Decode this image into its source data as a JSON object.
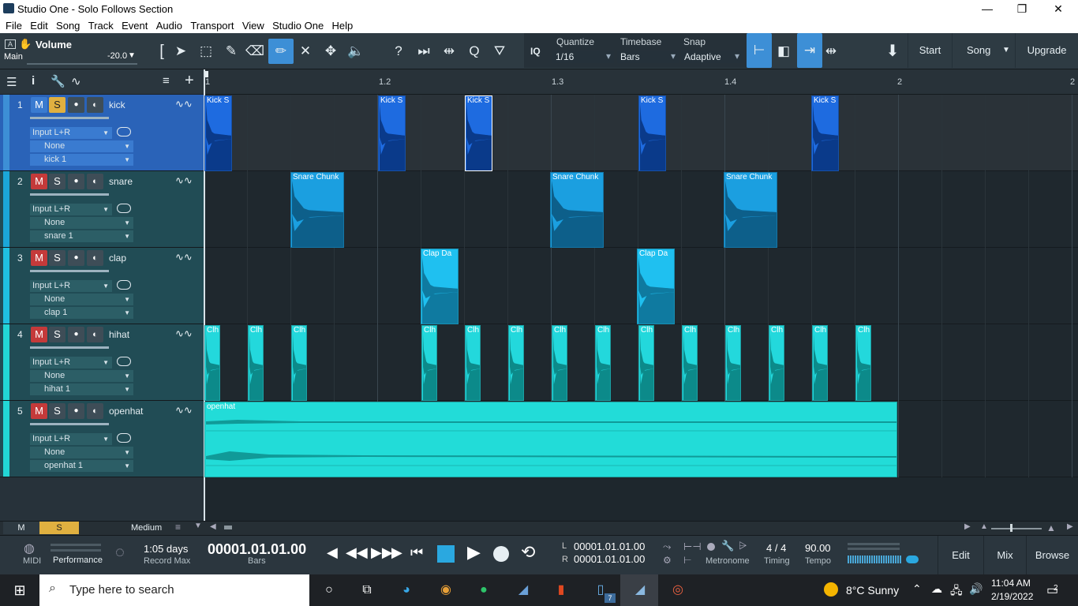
{
  "window": {
    "title": "Studio One - Solo Follows Section",
    "controls": [
      "—",
      "❐",
      "✕"
    ]
  },
  "menu": [
    "File",
    "Edit",
    "Song",
    "Track",
    "Event",
    "Audio",
    "Transport",
    "View",
    "Studio One",
    "Help"
  ],
  "toolbar": {
    "channel_label": "Volume",
    "channel_sub": "Main",
    "volume_value": "-20.0",
    "iq": "IQ",
    "quantize_label": "Quantize",
    "quantize_value": "1/16",
    "timebase_label": "Timebase",
    "timebase_value": "Bars",
    "snap_label": "Snap",
    "snap_value": "Adaptive",
    "start": "Start",
    "song": "Song",
    "upgrade": "Upgrade"
  },
  "ruler": [
    "1",
    "1.2",
    "1.3",
    "1.4",
    "2",
    "2"
  ],
  "tracks": [
    {
      "num": "1",
      "name": "kick",
      "input": "Input L+R",
      "none": "None",
      "inst": "kick 1",
      "color": "#2a63b8",
      "strip": "#3d8fd6"
    },
    {
      "num": "2",
      "name": "snare",
      "input": "Input L+R",
      "none": "None",
      "inst": "snare 1",
      "color": "#214c55",
      "strip": "#1ba7d8"
    },
    {
      "num": "3",
      "name": "clap",
      "input": "Input L+R",
      "none": "None",
      "inst": "clap 1",
      "color": "#214c55",
      "strip": "#1fc0e0"
    },
    {
      "num": "4",
      "name": "hihat",
      "input": "Input L+R",
      "none": "None",
      "inst": "hihat 1",
      "color": "#214c55",
      "strip": "#22d6d6"
    },
    {
      "num": "5",
      "name": "openhat",
      "input": "Input L+R",
      "none": "None",
      "inst": "openhat 1",
      "color": "#214c55",
      "strip": "#22d6d6"
    }
  ],
  "track_buttons": {
    "m": "M",
    "s": "S"
  },
  "clips": {
    "kick": "Kick S",
    "snare": "Snare Chunk",
    "clap": "Clap Da",
    "hihat": "Clh",
    "openhat": "openhat"
  },
  "bottom": {
    "m": "M",
    "s": "S",
    "zoom": "Medium"
  },
  "transport": {
    "midi": "MIDI",
    "performance": "Performance",
    "days": "1:05 days",
    "record_max": "Record Max",
    "position": "00001.01.01.00",
    "pos_unit": "Bars",
    "l_label": "L",
    "l_value": "00001.01.01.00",
    "r_label": "R",
    "r_value": "00001.01.01.00",
    "metronome": "Metronome",
    "timing_val": "4 / 4",
    "timing": "Timing",
    "tempo_val": "90.00",
    "tempo": "Tempo",
    "edit": "Edit",
    "mix": "Mix",
    "browse": "Browse"
  },
  "taskbar": {
    "search": "Type here to search",
    "weather": "8°C  Sunny",
    "time": "11:04 AM",
    "date": "2/19/2022",
    "notif": "2",
    "badge": "7"
  }
}
